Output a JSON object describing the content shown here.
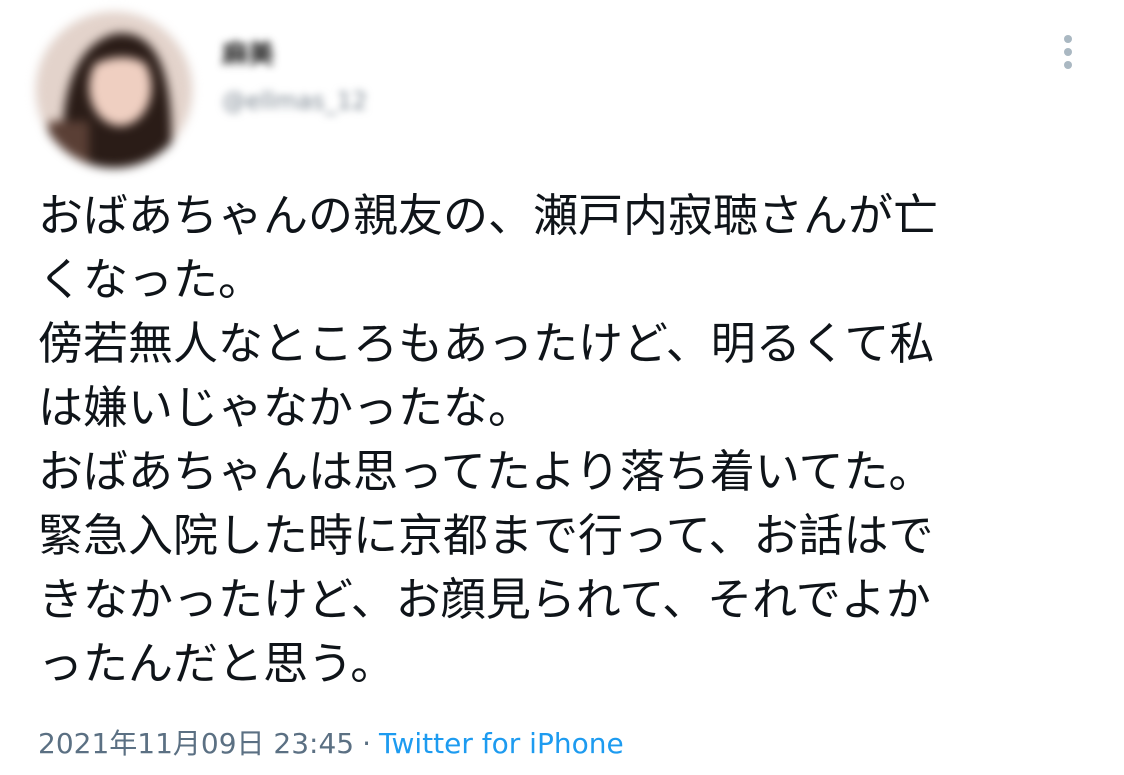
{
  "tweet": {
    "author": {
      "display_name": "麻美",
      "handle": "@ellmas_12",
      "avatar": "blurred-profile-photo"
    },
    "text_lines": [
      "おばあちゃんの親友の、瀬戸内寂聴さんが亡",
      "くなった。",
      "傍若無人なところもあったけど、明るくて私",
      "は嫌いじゃなかったな。",
      "おばあちゃんは思ってたより落ち着いてた。",
      "緊急入院した時に京都まで行って、お話はで",
      "きなかったけど、お顔見られて、それでよか",
      "ったんだと思う。"
    ],
    "timestamp": "2021年11月09日 23:45",
    "separator": "·",
    "source": "Twitter for iPhone",
    "more_icon": "vertical-ellipsis-icon"
  },
  "colors": {
    "text": "#0f1419",
    "muted": "#5b7083",
    "link": "#1d9bf0",
    "icon": "#aab8c2"
  }
}
